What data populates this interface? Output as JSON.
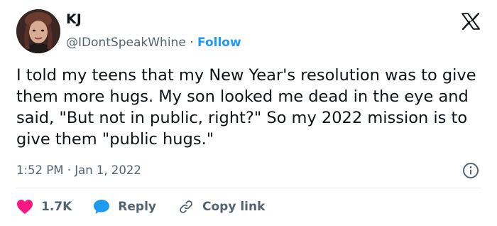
{
  "author": {
    "name": "KJ",
    "handle": "@IDontSpeakWhine",
    "separator": " · ",
    "follow_label": "Follow"
  },
  "tweet": {
    "text": "I told my teens that my New Year's resolution was to give them more hugs. My son looked me dead in the eye and said, \"But not in public, right?\" So my 2022 mission is to give them \"public hugs.\"",
    "timestamp": "1:52 PM · Jan 1, 2022"
  },
  "actions": {
    "like_count": "1.7K",
    "reply_label": "Reply",
    "copy_link_label": "Copy link"
  },
  "icons": {
    "logo": "x-logo-icon",
    "info": "info-icon",
    "like": "heart-icon",
    "reply": "speech-bubble-icon",
    "copy_link": "link-icon"
  },
  "colors": {
    "text": "#0f1419",
    "secondary": "#536471",
    "accent": "#1d9bf0",
    "like": "#f91880",
    "divider": "#e6ecf0"
  }
}
